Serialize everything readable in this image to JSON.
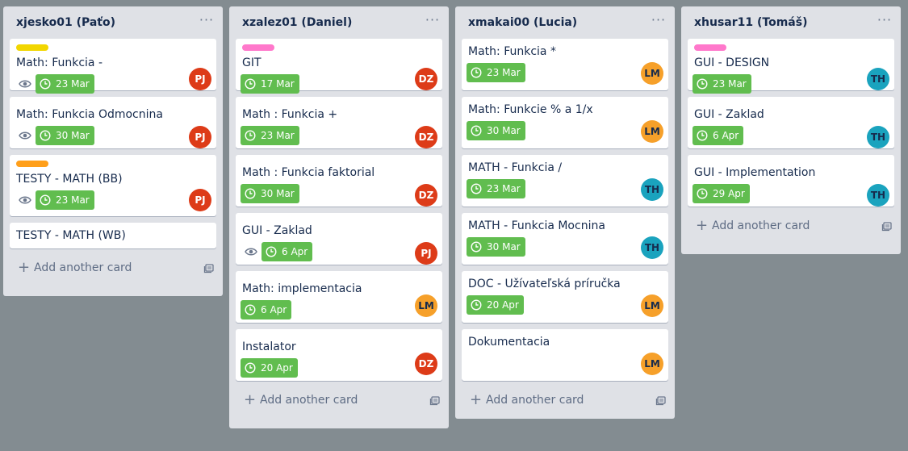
{
  "lists": [
    {
      "title": "xjesko01 (Paťo)",
      "menu": "···",
      "add_card": "Add another card",
      "cards": [
        {
          "label_color": "#f2d600",
          "title": "Math: Funkcia -",
          "watch": true,
          "date": "23 Mar",
          "avatar": "PJ"
        },
        {
          "title": "Math: Funkcia Odmocnina",
          "watch": true,
          "date": "30 Mar",
          "avatar": "PJ"
        },
        {
          "label_color": "#ff9f1a",
          "title": "TESTY - MATH (BB)",
          "watch": true,
          "date": "23 Mar",
          "avatar": "PJ"
        },
        {
          "title": "TESTY - MATH (WB)"
        }
      ]
    },
    {
      "title": "xzalez01 (Daniel)",
      "menu": "···",
      "add_card": "Add another card",
      "cards": [
        {
          "label_color": "#ff78cb",
          "title": "GIT",
          "date": "17 Mar",
          "avatar": "DZ"
        },
        {
          "title": "Math : Funkcia +",
          "date": "23 Mar",
          "avatar": "DZ"
        },
        {
          "title": "Math : Funkcia faktorial",
          "date": "30 Mar",
          "avatar": "DZ"
        },
        {
          "title": "GUI - Zaklad",
          "watch": true,
          "date": "6 Apr",
          "avatar": "PJ"
        },
        {
          "title": "Math: implementacia",
          "date": "6 Apr",
          "avatar": "LM"
        },
        {
          "title": "Instalator",
          "date": "20 Apr",
          "avatar": "DZ"
        }
      ]
    },
    {
      "title": "xmakai00 (Lucia)",
      "menu": "···",
      "add_card": "Add another card",
      "cards": [
        {
          "title": "Math: Funkcia *",
          "date": "23 Mar",
          "avatar": "LM"
        },
        {
          "title": "Math: Funkcie % a 1/x",
          "date": "30 Mar",
          "avatar": "LM"
        },
        {
          "title": "MATH - Funkcia /",
          "date": "23 Mar",
          "avatar": "TH"
        },
        {
          "title": "MATH - Funkcia Mocnina",
          "date": "30 Mar",
          "avatar": "TH"
        },
        {
          "title": "DOC - Užívateľská príručka",
          "date": "20 Apr",
          "avatar": "LM"
        },
        {
          "title": "Dokumentacia",
          "avatar": "LM"
        }
      ]
    },
    {
      "title": "xhusar11 (Tomáš)",
      "menu": "···",
      "add_card": "Add another card",
      "cards": [
        {
          "label_color": "#ff78cb",
          "title": "GUI - DESIGN",
          "date": "23 Mar",
          "avatar": "TH"
        },
        {
          "title": "GUI - Zaklad",
          "date": "6 Apr",
          "avatar": "TH"
        },
        {
          "title": "GUI - Implementation",
          "date": "29 Apr",
          "avatar": "TH"
        }
      ]
    }
  ]
}
